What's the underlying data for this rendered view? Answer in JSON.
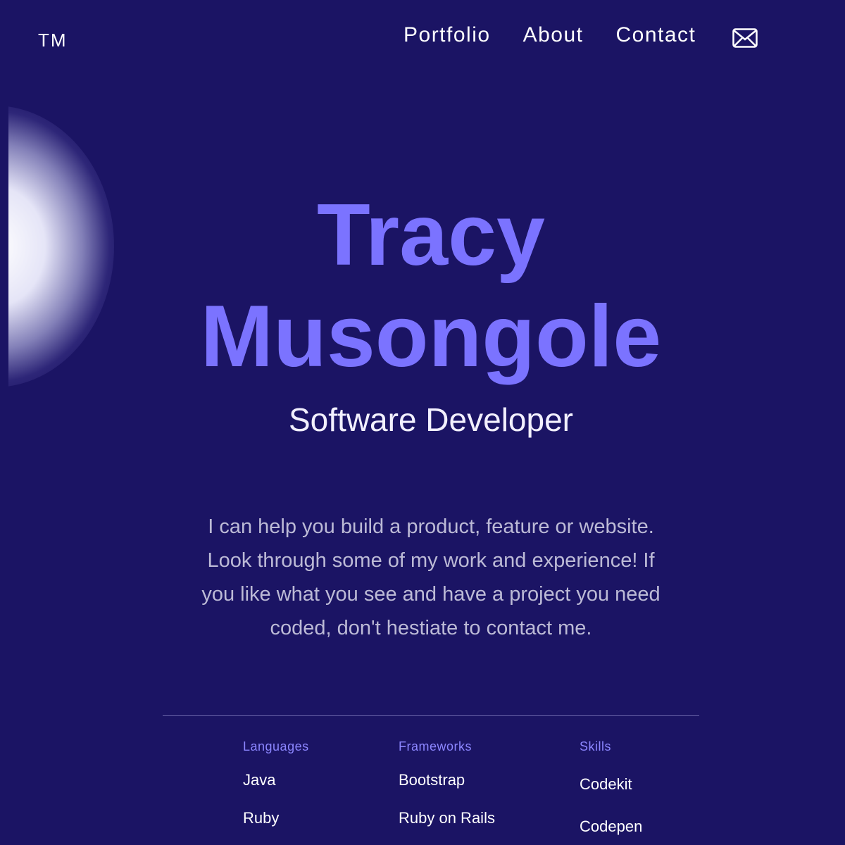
{
  "header": {
    "logo": "TM",
    "nav": [
      "Portfolio",
      "About",
      "Contact"
    ],
    "mail_icon": "envelope-icon"
  },
  "hero": {
    "first_name": "Tracy",
    "last_name": "Musongole",
    "subtitle": "Software Developer"
  },
  "intro": "I can help you build a product, feature or website. Look through some of my work and experience! If you like what you see and have a project you need coded, don't hestiate to contact me.",
  "skills": {
    "languages": {
      "heading": "Languages",
      "items": [
        "Java",
        "Ruby"
      ]
    },
    "frameworks": {
      "heading": "Frameworks",
      "items": [
        "Bootstrap",
        "Ruby on Rails"
      ]
    },
    "skills": {
      "heading": "Skills",
      "items": [
        "Codekit",
        "Codepen"
      ]
    }
  },
  "colors": {
    "background": "#1b1464",
    "accent": "#7b73ff",
    "heading_label": "#8c86ff",
    "body_text": "#bcbad6"
  }
}
